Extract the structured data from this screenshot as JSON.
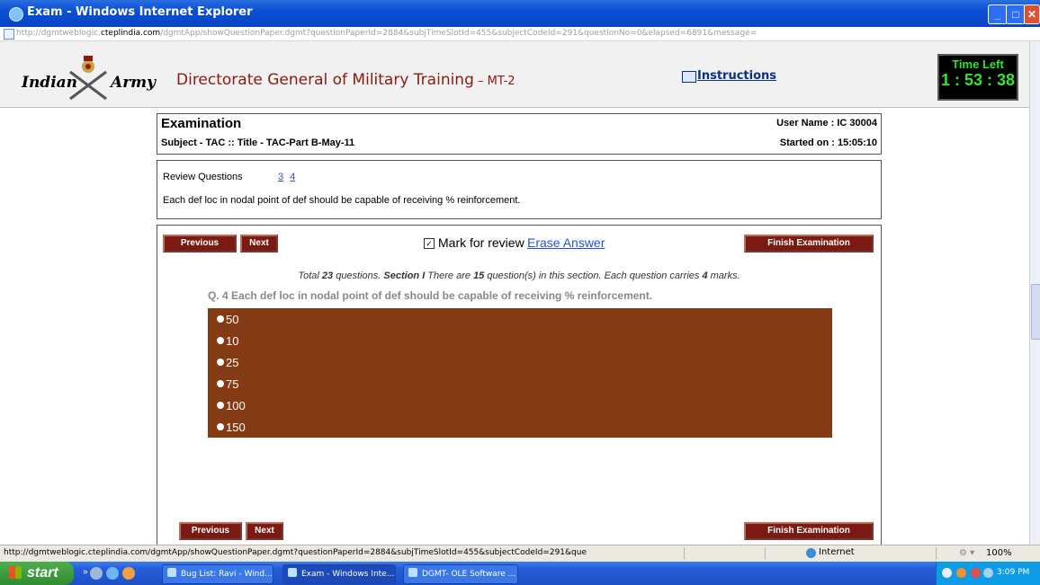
{
  "window": {
    "title": "Exam - Windows Internet Explorer",
    "url_prefix": "http://dgmtweblogic.",
    "url_domain": "cteplindia.com",
    "url_rest": "/dgmtApp/showQuestionPaper.dgmt?questionPaperId=2884&subjTimeSlotId=455&subjectCodeId=291&questionNo=0&elapsed=6891&message="
  },
  "header": {
    "logo_left": "Indian",
    "logo_right": "Army",
    "title": "Directorate General of Military Training",
    "title_suffix": " – MT-2",
    "instructions": "Instructions",
    "timer_label": "Time Left",
    "timer_value": "1 : 53 : 38"
  },
  "exam": {
    "heading": "Examination",
    "subject": "Subject - TAC :: Title - TAC-Part B-May-11",
    "user": "User Name : IC 30004",
    "started": "Started on : 15:05:10"
  },
  "review": {
    "label": "Review Questions",
    "links": [
      "3",
      "4"
    ],
    "text": "Each def loc in nodal point of def should be capable of receiving % reinforcement."
  },
  "question": {
    "prev": "Previous",
    "next": "Next",
    "finish": "Finish Examination",
    "mark_checked": "✓",
    "mark_label": "Mark for review",
    "erase": "Erase Answer",
    "total_a": "Total ",
    "total_n": "23",
    "total_b": " questions. ",
    "section": "Section I",
    "total_c": " There are ",
    "section_n": "15",
    "total_d": " question(s) in this section. Each question carries ",
    "marks": "4",
    "total_e": " marks.",
    "text": "Q. 4  Each def loc in nodal point of def should be capable of receiving % reinforcement.",
    "options": [
      "50",
      "10",
      "25",
      "75",
      "100",
      "150"
    ]
  },
  "statusbar": {
    "url": "http://dgmtweblogic.cteplindia.com/dgmtApp/showQuestionPaper.dgmt?questionPaperId=2884&subjTimeSlotId=455&subjectCodeId=291&que",
    "zone": "Internet",
    "zoom": "100%"
  },
  "taskbar": {
    "start": "start",
    "tasks": [
      "Bug List: Ravi - Wind...",
      "Exam - Windows Inte...",
      "DGMT- OLE Software ..."
    ],
    "clock": "3:09 PM"
  }
}
